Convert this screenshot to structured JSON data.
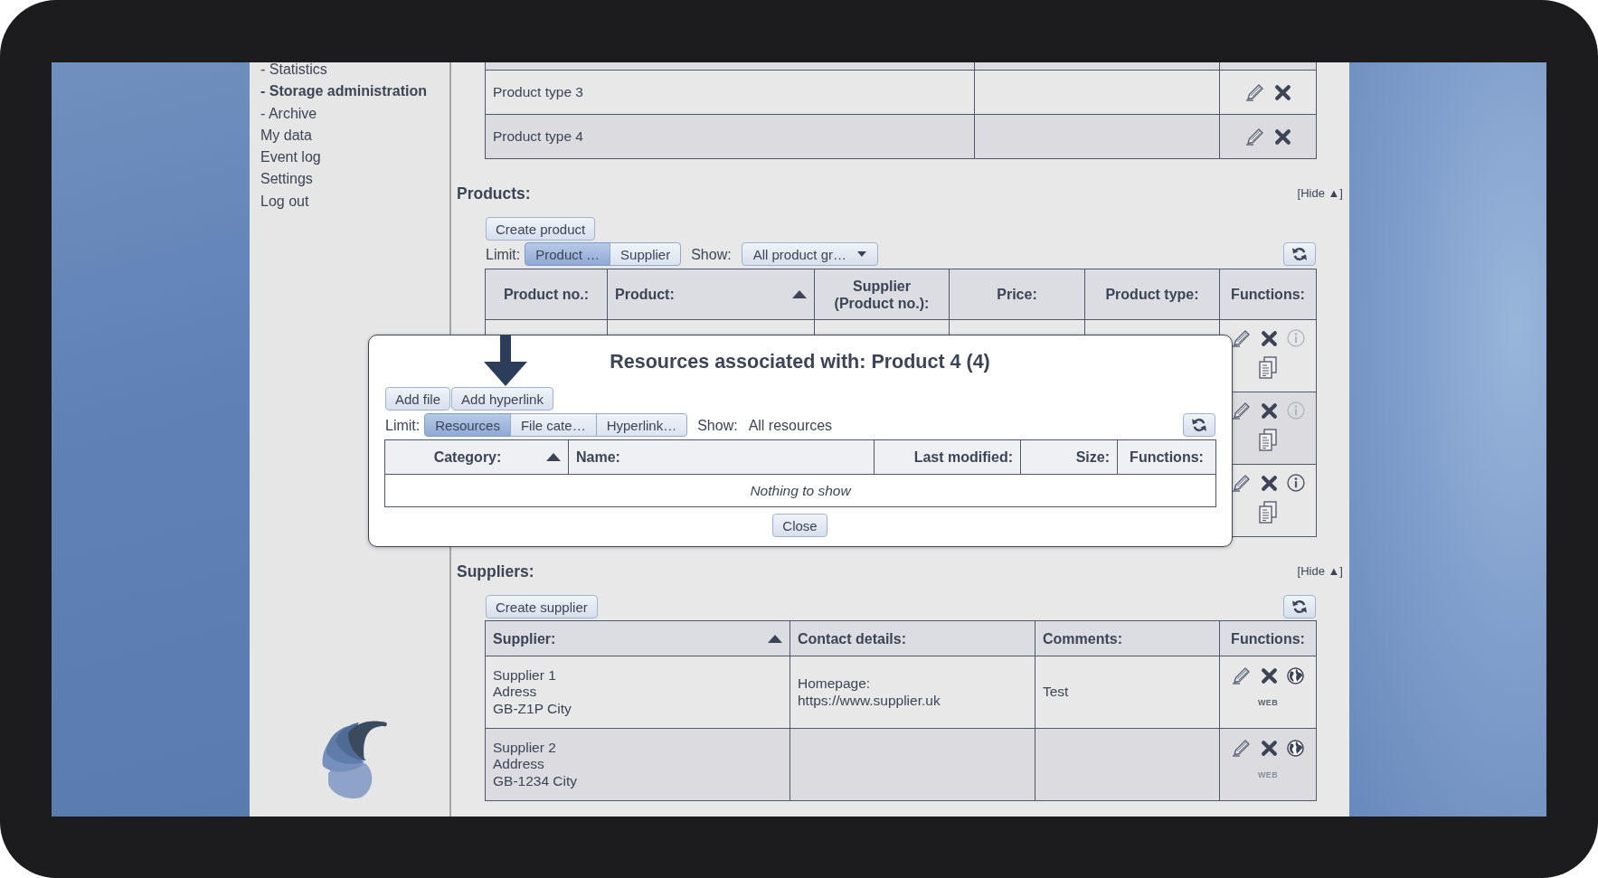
{
  "sidebar": {
    "items": [
      {
        "label": "- Statistics",
        "selected": false
      },
      {
        "label": "- Storage administration",
        "selected": true
      },
      {
        "label": "- Archive",
        "selected": false
      },
      {
        "label": "My data",
        "selected": false
      },
      {
        "label": "Event log",
        "selected": false
      },
      {
        "label": "Settings",
        "selected": false
      },
      {
        "label": "Log out",
        "selected": false
      }
    ]
  },
  "product_types": {
    "rows": [
      {
        "name": "Product type 3"
      },
      {
        "name": "Product type 4"
      }
    ]
  },
  "products": {
    "title": "Products:",
    "hide_link": "[Hide ▲]",
    "create_button": "Create product",
    "limit_label": "Limit:",
    "limit_options": [
      {
        "label": "Product …",
        "selected": true
      },
      {
        "label": "Supplier",
        "selected": false
      }
    ],
    "show_label": "Show:",
    "show_dropdown": "All product gr…",
    "table": {
      "columns": [
        {
          "label": "Product no.:",
          "sorted": false
        },
        {
          "label": "Product:",
          "sorted": true
        },
        {
          "label": "Supplier\n(Product no.):",
          "sorted": false
        },
        {
          "label": "Price:",
          "sorted": false
        },
        {
          "label": "Product type:",
          "sorted": false
        },
        {
          "label": "Functions:",
          "sorted": false
        }
      ],
      "rows": [
        {
          "info_enabled": false
        },
        {
          "info_enabled": false
        },
        {
          "info_enabled": true
        }
      ]
    }
  },
  "resources_dialog": {
    "title": "Resources associated with: Product 4 (4)",
    "buttons": [
      "Add file",
      "Add hyperlink"
    ],
    "limit_label": "Limit:",
    "limit_options": [
      {
        "label": "Resources",
        "selected": true
      },
      {
        "label": "File cate…",
        "selected": false
      },
      {
        "label": "Hyperlink…",
        "selected": false
      }
    ],
    "show_label": "Show:",
    "show_value": "All resources",
    "table": {
      "columns": [
        {
          "label": "Category:",
          "sorted": true
        },
        {
          "label": "Name:",
          "sorted": false
        },
        {
          "label": "Last modified:",
          "sorted": false
        },
        {
          "label": "Size:",
          "sorted": false
        },
        {
          "label": "Functions:",
          "sorted": false
        }
      ],
      "empty_message": "Nothing to show"
    },
    "close_button": "Close"
  },
  "suppliers": {
    "title": "Suppliers:",
    "hide_link": "[Hide ▲]",
    "create_button": "Create supplier",
    "table": {
      "columns": [
        {
          "label": "Supplier:",
          "sorted": true
        },
        {
          "label": "Contact details:",
          "sorted": false
        },
        {
          "label": "Comments:",
          "sorted": false
        },
        {
          "label": "Functions:",
          "sorted": false
        }
      ],
      "rows": [
        {
          "supplier": "Supplier 1\nAdress\nGB-Z1P City",
          "contact": "Homepage:\nhttps://www.supplier.uk",
          "comments": "Test",
          "web_label": "WEB",
          "web_enabled": true
        },
        {
          "supplier": "Supplier 2\nAddress\nGB-1234 City",
          "web_label": "WEB",
          "web_enabled": false
        }
      ]
    }
  }
}
